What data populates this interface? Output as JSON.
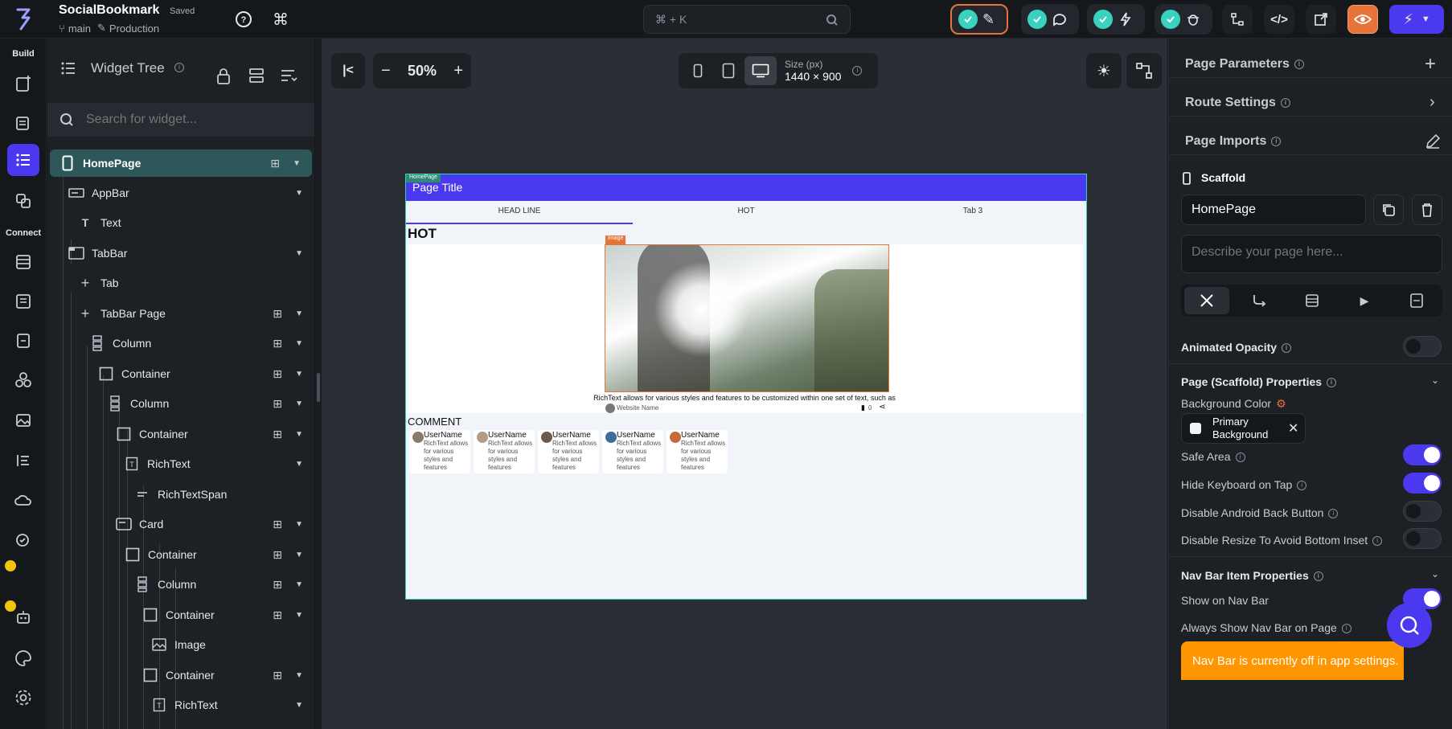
{
  "topbar": {
    "app_name": "SocialBookmark",
    "save_state": "Saved",
    "branch": "main",
    "environment": "Production",
    "search_placeholder": "⌘ + K"
  },
  "rail": {
    "build_label": "Build",
    "connect_label": "Connect"
  },
  "tree": {
    "title": "Widget Tree",
    "search_placeholder": "Search for widget...",
    "items": [
      {
        "label": "HomePage",
        "icon": "phone-icon"
      },
      {
        "label": "AppBar",
        "icon": "appbar-icon"
      },
      {
        "label": "Text",
        "icon": "text-icon"
      },
      {
        "label": "TabBar",
        "icon": "tabbar-icon"
      },
      {
        "label": "Tab",
        "icon": "plus-icon"
      },
      {
        "label": "TabBar Page",
        "icon": "plus-icon"
      },
      {
        "label": "Column",
        "icon": "column-icon"
      },
      {
        "label": "Container",
        "icon": "container-icon"
      },
      {
        "label": "Column",
        "icon": "column-icon"
      },
      {
        "label": "Container",
        "icon": "container-icon"
      },
      {
        "label": "RichText",
        "icon": "richtext-icon"
      },
      {
        "label": "RichTextSpan",
        "icon": "span-icon"
      },
      {
        "label": "Card",
        "icon": "card-icon"
      },
      {
        "label": "Container",
        "icon": "container-icon"
      },
      {
        "label": "Column",
        "icon": "column-icon"
      },
      {
        "label": "Container",
        "icon": "container-icon"
      },
      {
        "label": "Image",
        "icon": "image-icon"
      },
      {
        "label": "Container",
        "icon": "container-icon"
      },
      {
        "label": "RichText",
        "icon": "richtext-icon"
      }
    ]
  },
  "canvas": {
    "zoom": "50%",
    "size_label": "Size (px)",
    "size_value": "1440 × 900"
  },
  "preview": {
    "page_tag": "HomePage",
    "page_title": "Page Title",
    "tabs": [
      "HEAD LINE",
      "HOT",
      "Tab 3"
    ],
    "section_title": "HOT",
    "image_tag": "Image",
    "caption": "RichText allows for various styles and features to be customized within one set of text, such as",
    "website_name": "Website Name",
    "bookmark_count": "0",
    "comment_title": "COMMENT",
    "comments": [
      {
        "user": "UserName",
        "text": "RichText allows for various styles and features"
      },
      {
        "user": "UserName",
        "text": "RichText allows for various styles and features"
      },
      {
        "user": "UserName",
        "text": "RichText allows for various styles and features"
      },
      {
        "user": "UserName",
        "text": "RichText allows for various styles and features"
      },
      {
        "user": "UserName",
        "text": "RichText allows for various styles and features"
      }
    ]
  },
  "props": {
    "page_parameters": "Page Parameters",
    "route_settings": "Route Settings",
    "page_imports": "Page Imports",
    "scaffold": "Scaffold",
    "page_name": "HomePage",
    "describe_placeholder": "Describe your page here...",
    "animated_opacity": "Animated Opacity",
    "scaffold_props": "Page (Scaffold) Properties",
    "bg_color_label": "Background Color",
    "bg_color_value_1": "Primary",
    "bg_color_value_2": "Background",
    "safe_area": "Safe Area",
    "hide_keyboard": "Hide Keyboard on Tap",
    "disable_back": "Disable Android Back Button",
    "disable_resize": "Disable Resize To Avoid Bottom Inset",
    "nav_bar_props": "Nav Bar Item Properties",
    "show_nav": "Show on Nav Bar",
    "always_show_nav": "Always Show Nav Bar on Page",
    "nav_bar_warning": "Nav Bar is currently off in app settings.",
    "toggles": {
      "animated_opacity": false,
      "safe_area": true,
      "hide_keyboard": true,
      "disable_back": false,
      "disable_resize": false,
      "show_nav": true
    }
  },
  "colors": {
    "accent": "#4b39ef",
    "success": "#39d2c0",
    "warning": "#ff9500",
    "panel": "#1d2125"
  }
}
